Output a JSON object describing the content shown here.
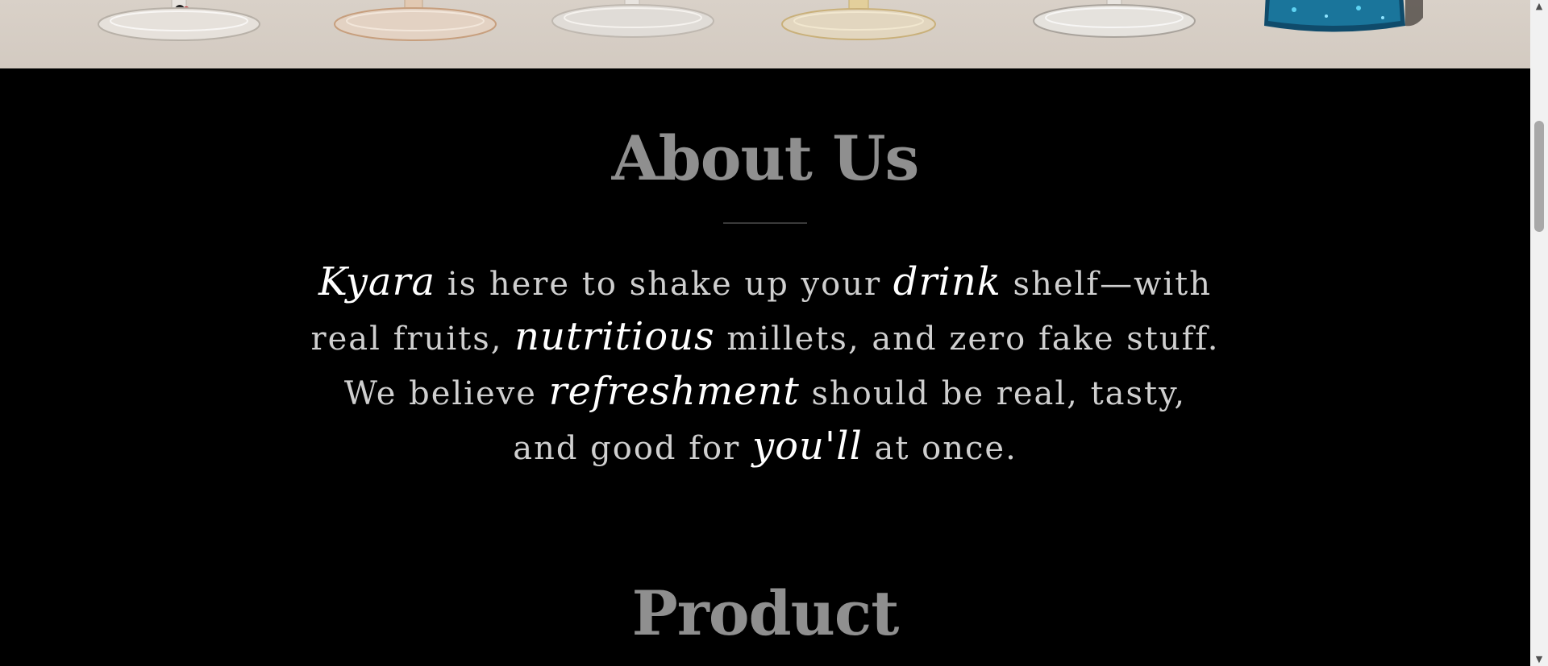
{
  "about": {
    "title": "About Us",
    "text_parts": [
      {
        "text": "Kyara",
        "emphasis": true
      },
      {
        "text": " is here to shake up your ",
        "emphasis": false
      },
      {
        "text": "drink",
        "emphasis": true
      },
      {
        "text": " shelf—with real fruits, ",
        "emphasis": false
      },
      {
        "text": "nutritious",
        "emphasis": true
      },
      {
        "text": " millets, and zero fake stuff. We believe ",
        "emphasis": false
      },
      {
        "text": "refreshment",
        "emphasis": true
      },
      {
        "text": " should be real, tasty, and good for ",
        "emphasis": false
      },
      {
        "text": "you'll",
        "emphasis": true
      },
      {
        "text": " at once.",
        "emphasis": false
      }
    ]
  },
  "product": {
    "title": "Product"
  },
  "scrollbar": {
    "up_arrow": "▲",
    "down_arrow": "▼"
  },
  "colors": {
    "background": "#000000",
    "heading": "#8f8f8f",
    "body_text": "#cfcfcf",
    "emphasis_text": "#ffffff",
    "hero_background": "#d6cec5"
  }
}
